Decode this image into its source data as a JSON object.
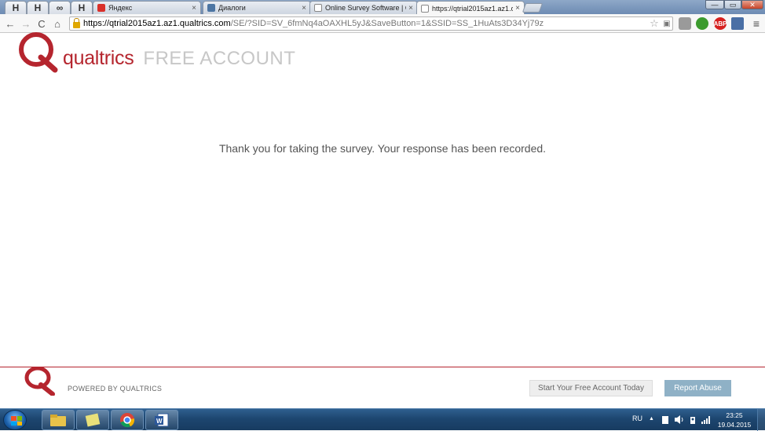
{
  "browser": {
    "pinned_tabs": [
      {
        "label": "H"
      },
      {
        "label": "H"
      },
      {
        "label": "∞"
      },
      {
        "label": "H"
      }
    ],
    "tabs": [
      {
        "title": "Яндекс",
        "favicon_color": "#d9302a"
      },
      {
        "title": "Диалоги",
        "favicon_color": "#4c75a3"
      },
      {
        "title": "Online Survey Software | Q",
        "favicon_color": "#ffffff"
      },
      {
        "title": "https://qtrial2015az1.az1.q",
        "favicon_color": "#ffffff"
      }
    ],
    "close_glyph": "×",
    "window_controls": {
      "minimize": "—",
      "maximize": "▭",
      "close": "✕"
    },
    "nav": {
      "back": "←",
      "forward": "→",
      "reload": "C",
      "home": "⌂"
    },
    "url": {
      "host": "https://qtrial2015az1.az1.qualtrics.com",
      "path": "/SE/?SID=SV_6fmNq4aOAXHL5yJ&SaveButton=1&SSID=SS_1HuAts3D34Yj79z"
    },
    "star_glyph": "☆",
    "menu_glyph": "≡",
    "extensions": [
      {
        "name": "shield-extension-icon",
        "color": "#8a8a8a",
        "label": ""
      },
      {
        "name": "green-refresh-extension-icon",
        "color": "#3c9b2e",
        "label": ""
      },
      {
        "name": "adblock-plus-icon",
        "color": "#d6201f",
        "label": "ABP"
      },
      {
        "name": "list-extension-icon",
        "color": "#4a6fa5",
        "label": ""
      }
    ]
  },
  "page": {
    "logo_word": "qualtrics",
    "logo_free": "FREE ACCOUNT",
    "message": "Thank you for taking the survey. Your response has been recorded.",
    "footer": {
      "powered_by": "POWERED BY QUALTRICS",
      "free_account_button": "Start Your Free Account Today",
      "report_abuse_button": "Report Abuse"
    },
    "brand_color": "#b5252e"
  },
  "taskbar": {
    "language": "RU",
    "tray_arrow": "▲",
    "time": "23:25",
    "date": "19.04.2015"
  }
}
